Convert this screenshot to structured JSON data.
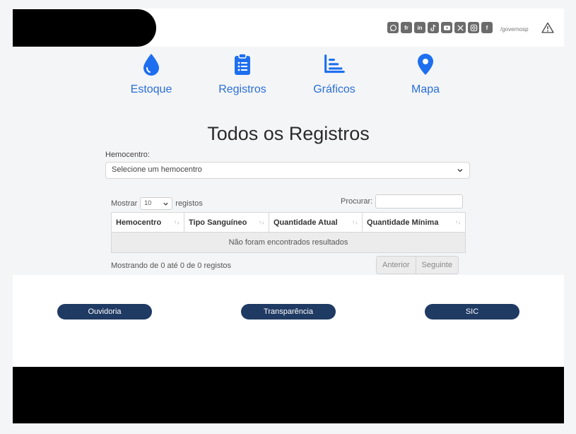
{
  "header": {
    "social_icons": [
      "whatsapp-icon",
      "flickr-icon",
      "linkedin-icon",
      "tiktok-icon",
      "youtube-icon",
      "x-icon",
      "instagram-icon",
      "facebook-icon"
    ],
    "social_labels": {
      "flickr": "fr",
      "linkedin": "in",
      "facebook": "f"
    },
    "handle": "/governosp"
  },
  "nav": [
    {
      "label": "Estoque",
      "icon": "drop-icon"
    },
    {
      "label": "Registros",
      "icon": "clipboard-list-icon"
    },
    {
      "label": "Gráficos",
      "icon": "bar-chart-icon"
    },
    {
      "label": "Mapa",
      "icon": "map-pin-icon"
    }
  ],
  "main": {
    "title": "Todos os Registros",
    "hemocentro_label": "Hemocentro:",
    "hemocentro_select": "Selecione um hemocentro",
    "show_label": "Mostrar",
    "page_length": "10",
    "records_label": "registos",
    "search_label": "Procurar:",
    "search_value": "",
    "table": {
      "columns": [
        "Hemocentro",
        "Tipo Sanguíneo",
        "Quantidade Atual",
        "Quantidade Mínima"
      ],
      "empty_message": "Não foram encontrados resultados"
    },
    "info": "Mostrando de 0 até 0 de 0 registos",
    "prev": "Anterior",
    "next": "Seguinte"
  },
  "footer": {
    "links": [
      "Ouvidoria",
      "Transparência",
      "SIC"
    ]
  },
  "colors": {
    "accent": "#1e6ff0",
    "pill": "#1f3a63"
  }
}
